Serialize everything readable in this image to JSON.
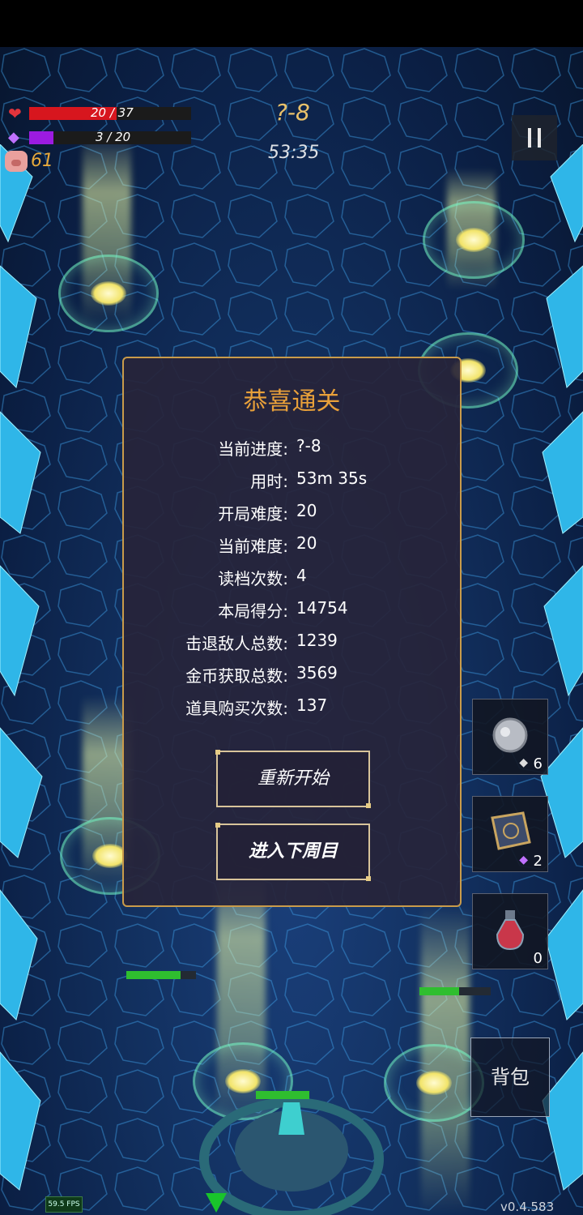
{
  "hud": {
    "hp_text": "20 / 37",
    "hp_fraction": 0.54,
    "mp_text": "3 / 20",
    "mp_fraction": 0.15,
    "coins": "61",
    "level": "?-8",
    "timer": "53:35"
  },
  "dialog": {
    "title": "恭喜通关",
    "stats": [
      {
        "label": "当前进度:",
        "value": "?-8"
      },
      {
        "label": "用时:",
        "value": "53m 35s"
      },
      {
        "label": "开局难度:",
        "value": "20"
      },
      {
        "label": "当前难度:",
        "value": "20"
      },
      {
        "label": "读档次数:",
        "value": "4"
      },
      {
        "label": "本局得分:",
        "value": "14754"
      },
      {
        "label": "击退敌人总数:",
        "value": "1239"
      },
      {
        "label": "金币获取总数:",
        "value": "3569"
      },
      {
        "label": "道具购买次数:",
        "value": "137"
      }
    ],
    "restart_label": "重新开始",
    "next_cycle_label": "进入下周目"
  },
  "inventory": [
    {
      "icon": "relic-orb-icon",
      "count": "6",
      "gem": "diamond"
    },
    {
      "icon": "mystery-box-icon",
      "count": "2",
      "gem": "purple-diamond"
    },
    {
      "icon": "red-potion-icon",
      "count": "0"
    }
  ],
  "bag_label": "背包",
  "fps": "59.5 FPS",
  "version": "v0.4.583",
  "colors": {
    "hp": "#d7161e",
    "mp": "#9c1be0",
    "gold": "#e8a03a",
    "panel_border": "#c99b4a"
  }
}
